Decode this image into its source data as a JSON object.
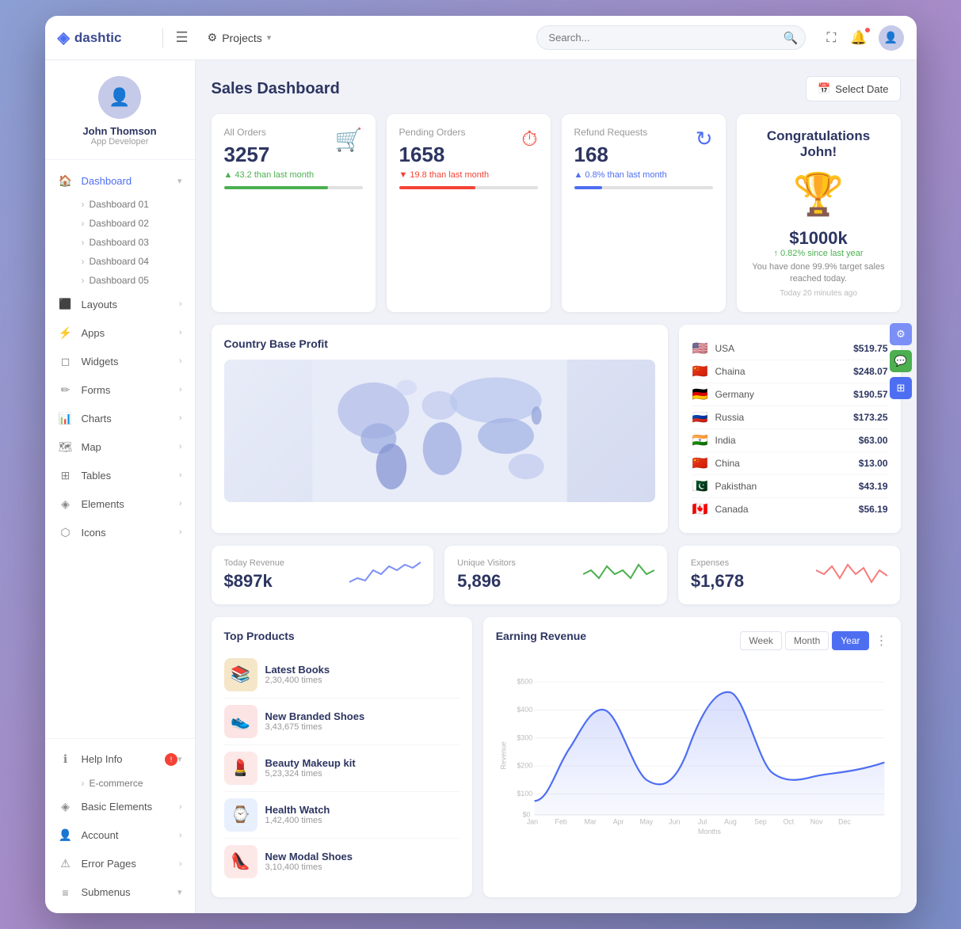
{
  "app": {
    "name": "dashtic",
    "logo_icon": "◈"
  },
  "topbar": {
    "menu_label": "☰",
    "projects_label": "Projects",
    "search_placeholder": "Search...",
    "search_icon": "🔍",
    "fullscreen_icon": "⛶",
    "notifications_icon": "🔔",
    "settings_icon": "⚙"
  },
  "sidebar": {
    "user": {
      "name": "John Thomson",
      "role": "App Developer"
    },
    "nav_items": [
      {
        "id": "dashboard",
        "label": "Dashboard",
        "icon": "🏠",
        "active": true,
        "has_submenu": true
      },
      {
        "id": "dashboard-01",
        "label": "Dashboard 01",
        "is_sub": true
      },
      {
        "id": "dashboard-02",
        "label": "Dashboard 02",
        "is_sub": true
      },
      {
        "id": "dashboard-03",
        "label": "Dashboard 03",
        "is_sub": true
      },
      {
        "id": "dashboard-04",
        "label": "Dashboard 04",
        "is_sub": true
      },
      {
        "id": "dashboard-05",
        "label": "Dashboard 05",
        "is_sub": true
      },
      {
        "id": "layouts",
        "label": "Layouts",
        "icon": "⬛",
        "arrow": "›"
      },
      {
        "id": "apps",
        "label": "Apps",
        "icon": "⚡",
        "arrow": "›"
      },
      {
        "id": "widgets",
        "label": "Widgets",
        "icon": "◻",
        "arrow": "›"
      },
      {
        "id": "forms",
        "label": "Forms",
        "icon": "✏",
        "arrow": "›"
      },
      {
        "id": "charts",
        "label": "Charts",
        "icon": "📊",
        "arrow": "›"
      },
      {
        "id": "map",
        "label": "Map",
        "icon": "🗺",
        "arrow": "›"
      },
      {
        "id": "tables",
        "label": "Tables",
        "icon": "⊞",
        "arrow": "›"
      },
      {
        "id": "elements",
        "label": "Elements",
        "icon": "◈",
        "arrow": "›"
      },
      {
        "id": "icons",
        "label": "Icons",
        "icon": "⬡",
        "arrow": "›"
      }
    ],
    "bottom_items": [
      {
        "id": "help-info",
        "label": "Help Info",
        "icon": "ℹ",
        "has_badge": true
      },
      {
        "id": "ecommerce",
        "label": "E-commerce",
        "icon": "🛒",
        "is_sub": true
      },
      {
        "id": "basic-elements",
        "label": "Basic Elements",
        "icon": "◈",
        "arrow": "›"
      },
      {
        "id": "account",
        "label": "Account",
        "icon": "👤",
        "arrow": "›"
      },
      {
        "id": "error-pages",
        "label": "Error Pages",
        "icon": "⚠",
        "arrow": "›"
      },
      {
        "id": "submenus",
        "label": "Submenus",
        "icon": "≡",
        "has_submenu": true
      }
    ]
  },
  "page": {
    "title": "Sales Dashboard",
    "select_date_label": "Select Date",
    "calendar_icon": "📅"
  },
  "stats": [
    {
      "id": "all-orders",
      "label": "All Orders",
      "value": "3257",
      "change": "43.2 than last month",
      "change_dir": "up",
      "icon": "🛒",
      "icon_color": "#4caf50",
      "progress": 75,
      "progress_color": "#4caf50"
    },
    {
      "id": "pending-orders",
      "label": "Pending Orders",
      "value": "1658",
      "change": "19.8 than last month",
      "change_dir": "down",
      "icon": "⏱",
      "icon_color": "#f44336",
      "progress": 55,
      "progress_color": "#f44336"
    },
    {
      "id": "refund-requests",
      "label": "Refund Requests",
      "value": "168",
      "change": "0.8% than last month",
      "change_dir": "up",
      "icon": "↻",
      "icon_color": "#4e6ef2",
      "progress": 20,
      "progress_color": "#4e6ef2"
    }
  ],
  "congrats": {
    "title": "Congratulations John!",
    "amount": "$1000k",
    "increase": "↑ 0.82% since last year",
    "description": "You have done 99.9% target sales reached today.",
    "time": "Today 20 minutes ago"
  },
  "country_base_profit": {
    "title": "Country Base Profit",
    "countries": [
      {
        "name": "USA",
        "flag": "🇺🇸",
        "amount": "$519.75"
      },
      {
        "name": "Chaina",
        "flag": "🇨🇳",
        "amount": "$248.07"
      },
      {
        "name": "Germany",
        "flag": "🇩🇪",
        "amount": "$190.57"
      },
      {
        "name": "Russia",
        "flag": "🇷🇺",
        "amount": "$173.25"
      },
      {
        "name": "India",
        "flag": "🇮🇳",
        "amount": "$63.00"
      },
      {
        "name": "China",
        "flag": "🇨🇳",
        "amount": "$13.00"
      },
      {
        "name": "Pakisthan",
        "flag": "🇵🇰",
        "amount": "$43.19"
      },
      {
        "name": "Canada",
        "flag": "🇨🇦",
        "amount": "$56.19"
      }
    ]
  },
  "revenue_cards": [
    {
      "id": "today-revenue",
      "label": "Today Revenue",
      "value": "$897k",
      "color": "#7b8ff7"
    },
    {
      "id": "unique-visitors",
      "label": "Unique Visitors",
      "value": "5,896",
      "color": "#4caf50"
    },
    {
      "id": "expenses",
      "label": "Expenses",
      "value": "$1,678",
      "color": "#f77b7b"
    }
  ],
  "top_products": {
    "title": "Top Products",
    "items": [
      {
        "name": "Latest Books",
        "times": "2,30,400 times",
        "color": "#f5e6c8",
        "emoji": "📚"
      },
      {
        "name": "New Branded Shoes",
        "times": "3,43,675 times",
        "color": "#fce4e4",
        "emoji": "👟"
      },
      {
        "name": "Beauty Makeup kit",
        "times": "5,23,324 times",
        "color": "#fde8e8",
        "emoji": "💄"
      },
      {
        "name": "Health Watch",
        "times": "1,42,400 times",
        "color": "#e8f0fe",
        "emoji": "⌚"
      },
      {
        "name": "New Modal Shoes",
        "times": "3,10,400 times",
        "color": "#fde8e8",
        "emoji": "👠"
      }
    ]
  },
  "earning_revenue": {
    "title": "Earning Revenue",
    "tabs": [
      "Week",
      "Month",
      "Year"
    ],
    "active_tab": "Year",
    "y_labels": [
      "$500",
      "$400",
      "$300",
      "$200",
      "$100",
      "$0"
    ],
    "x_labels": [
      "Jan",
      "Feb",
      "Mar",
      "Apr",
      "May",
      "Jun",
      "Jul",
      "Aug",
      "Sep",
      "Oct",
      "Nov",
      "Dec"
    ],
    "x_axis_label": "Months",
    "y_axis_label": "Revenue"
  },
  "right_fab": [
    {
      "id": "settings-fab",
      "color": "#7b8ff7",
      "icon": "⚙"
    },
    {
      "id": "chat-fab",
      "color": "#4caf50",
      "icon": "💬"
    },
    {
      "id": "grid-fab",
      "color": "#4e6ef2",
      "icon": "⊞"
    }
  ]
}
